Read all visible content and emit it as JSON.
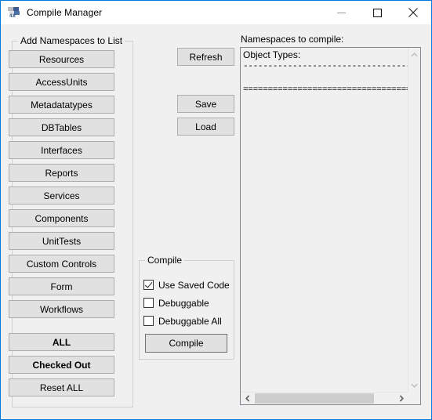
{
  "window": {
    "title": "Compile Manager",
    "icon": "dotnet-framework-icon",
    "icon_version": "4.6",
    "accent_color": "#0078d7",
    "background_color": "#f0f0f0",
    "controls": {
      "minimize": "minimize-icon",
      "maximize": "maximize-icon",
      "close": "close-icon"
    }
  },
  "namespaces_group": {
    "legend": "Add Namespaces to List",
    "buttons": [
      {
        "label": "Resources",
        "bold": false
      },
      {
        "label": "AccessUnits",
        "bold": false
      },
      {
        "label": "Metadatatypes",
        "bold": false
      },
      {
        "label": "DBTables",
        "bold": false
      },
      {
        "label": "Interfaces",
        "bold": false
      },
      {
        "label": "Reports",
        "bold": false
      },
      {
        "label": "Services",
        "bold": false
      },
      {
        "label": "Components",
        "bold": false
      },
      {
        "label": "UnitTests",
        "bold": false
      },
      {
        "label": "Custom Controls",
        "bold": false
      },
      {
        "label": "Form",
        "bold": false
      },
      {
        "label": "Workflows",
        "bold": false
      },
      {
        "label": "ALL",
        "bold": true
      },
      {
        "label": "Checked Out",
        "bold": true
      },
      {
        "label": "Reset ALL",
        "bold": false
      }
    ]
  },
  "actions": {
    "refresh": "Refresh",
    "save": "Save",
    "load": "Load"
  },
  "compile_group": {
    "legend": "Compile",
    "checkboxes": [
      {
        "label": "Use Saved Code",
        "checked": true
      },
      {
        "label": "Debuggable",
        "checked": false
      },
      {
        "label": "Debuggable All",
        "checked": false
      }
    ],
    "compile_button": "Compile"
  },
  "list_panel": {
    "label": "Namespaces to compile:",
    "lines": [
      "Object Types:",
      "-----------------------------------",
      "",
      "========================================="
    ],
    "vertical_scrollbar": {
      "up_arrow": "chevron-up-icon",
      "down_arrow": "chevron-down-icon",
      "thumb_visible": false
    },
    "horizontal_scrollbar": {
      "left_arrow": "chevron-left-icon",
      "right_arrow": "chevron-right-icon",
      "thumb_visible": true
    }
  }
}
